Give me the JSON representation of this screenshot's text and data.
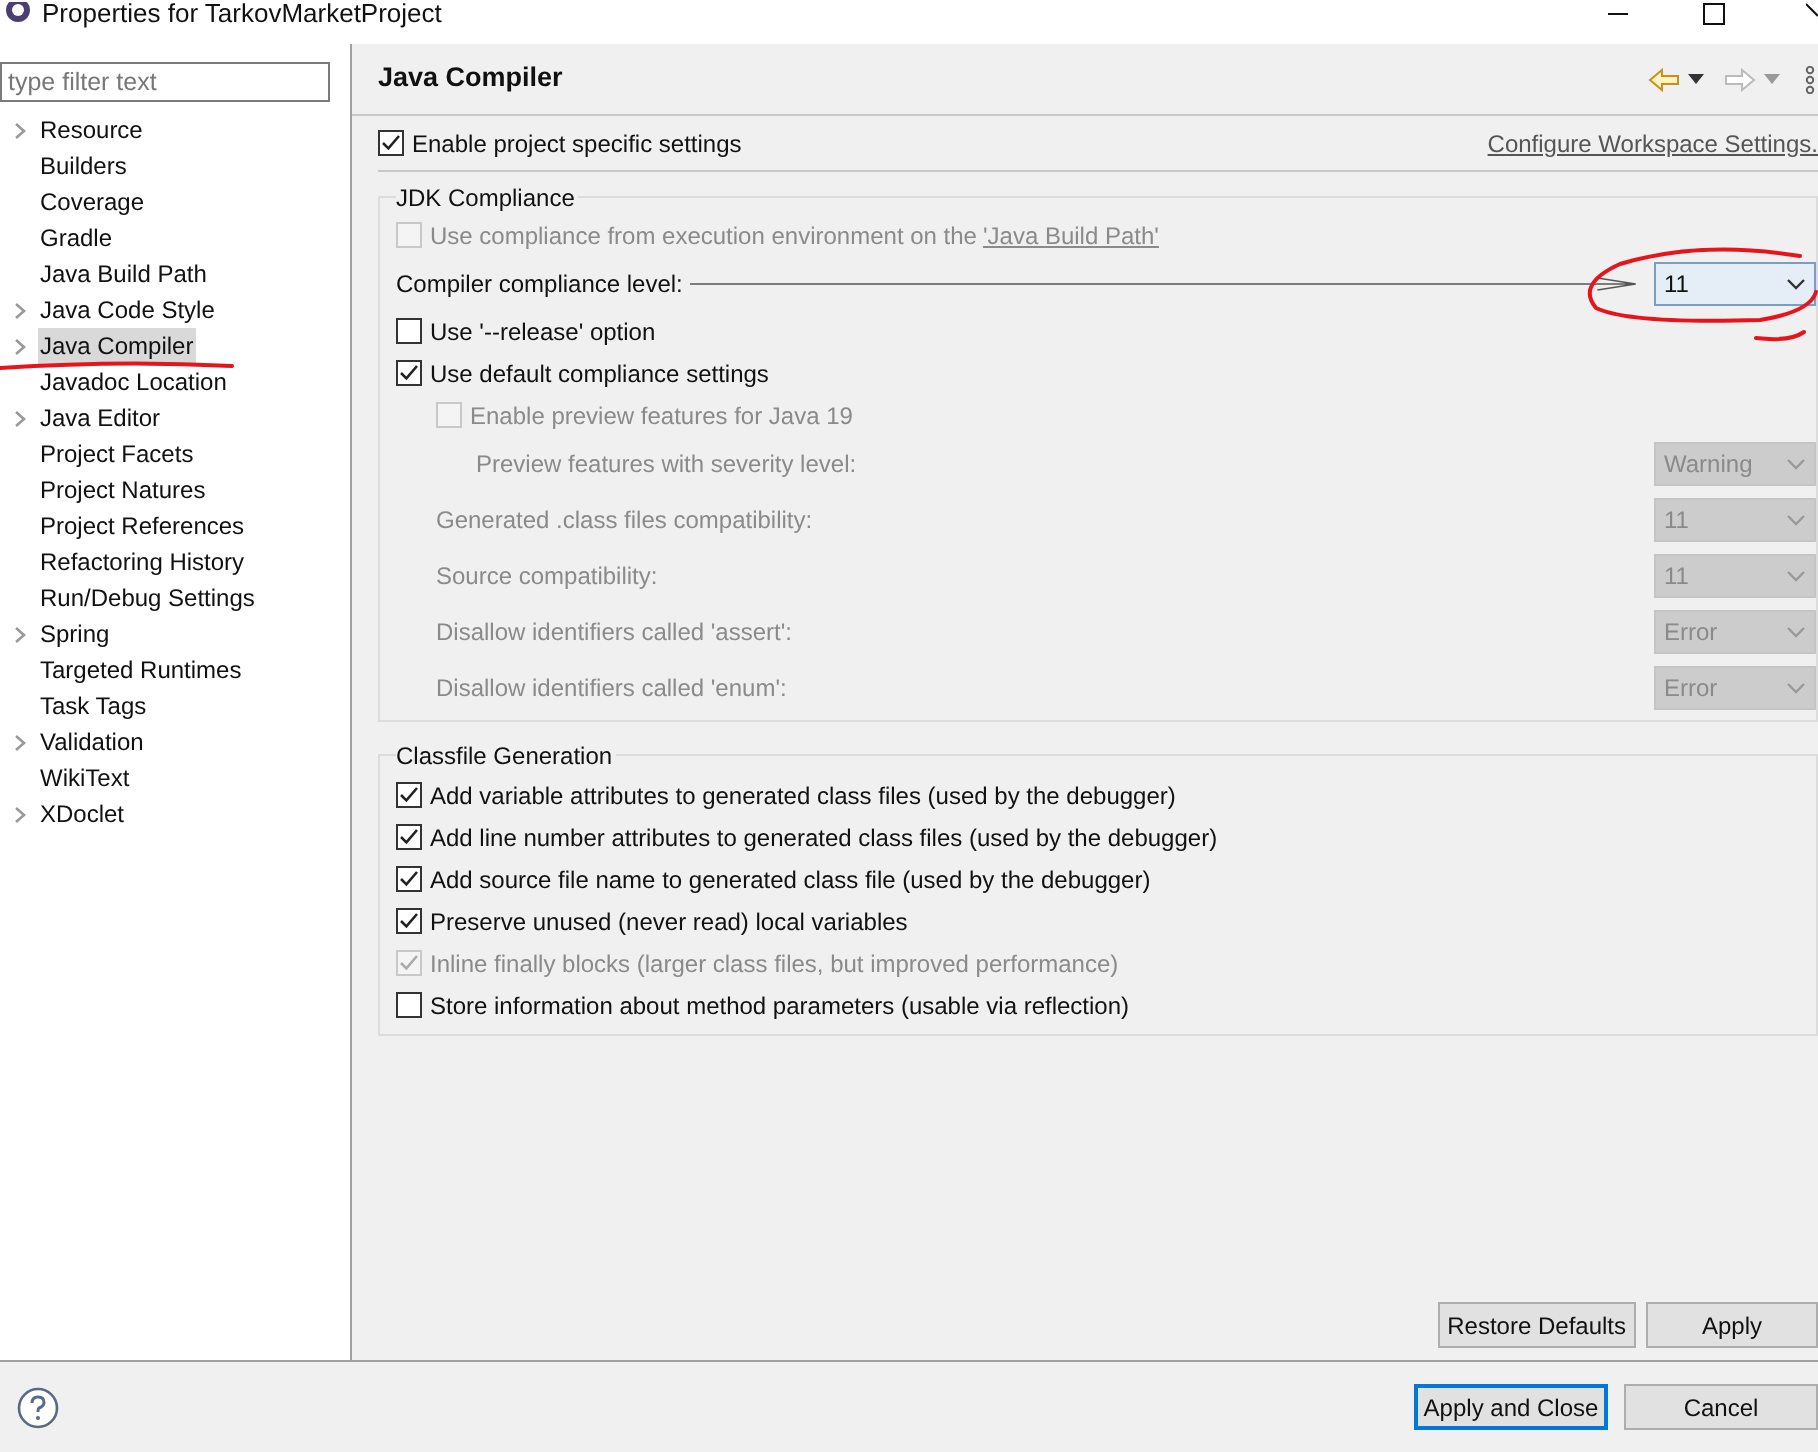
{
  "window": {
    "title": "Properties for TarkovMarketProject"
  },
  "sidebar": {
    "filter": {
      "placeholder": "type filter text"
    },
    "items": [
      {
        "label": "Resource",
        "expandable": true,
        "selected": false
      },
      {
        "label": "Builders",
        "expandable": false,
        "selected": false
      },
      {
        "label": "Coverage",
        "expandable": false,
        "selected": false
      },
      {
        "label": "Gradle",
        "expandable": false,
        "selected": false
      },
      {
        "label": "Java Build Path",
        "expandable": false,
        "selected": false
      },
      {
        "label": "Java Code Style",
        "expandable": true,
        "selected": false
      },
      {
        "label": "Java Compiler",
        "expandable": true,
        "selected": true
      },
      {
        "label": "Javadoc Location",
        "expandable": false,
        "selected": false
      },
      {
        "label": "Java Editor",
        "expandable": true,
        "selected": false
      },
      {
        "label": "Project Facets",
        "expandable": false,
        "selected": false
      },
      {
        "label": "Project Natures",
        "expandable": false,
        "selected": false
      },
      {
        "label": "Project References",
        "expandable": false,
        "selected": false
      },
      {
        "label": "Refactoring History",
        "expandable": false,
        "selected": false
      },
      {
        "label": "Run/Debug Settings",
        "expandable": false,
        "selected": false
      },
      {
        "label": "Spring",
        "expandable": true,
        "selected": false
      },
      {
        "label": "Targeted Runtimes",
        "expandable": false,
        "selected": false
      },
      {
        "label": "Task Tags",
        "expandable": false,
        "selected": false
      },
      {
        "label": "Validation",
        "expandable": true,
        "selected": false
      },
      {
        "label": "WikiText",
        "expandable": false,
        "selected": false
      },
      {
        "label": "XDoclet",
        "expandable": true,
        "selected": false
      }
    ]
  },
  "page": {
    "title": "Java Compiler",
    "enable_specific": {
      "label": "Enable project specific settings",
      "checked": true
    },
    "configure_link": "Configure Workspace Settings.",
    "jdk": {
      "title": "JDK Compliance",
      "use_ee": {
        "label": "Use compliance from execution environment on the ",
        "link": "'Java Build Path'",
        "checked": false,
        "disabled": true
      },
      "level": {
        "label": "Compiler compliance level:",
        "value": "11"
      },
      "release": {
        "label": "Use '--release' option",
        "checked": false,
        "disabled": false
      },
      "defaults": {
        "label": "Use default compliance settings",
        "checked": true,
        "disabled": false
      },
      "preview": {
        "label": "Enable preview features for Java 19",
        "checked": false,
        "disabled": true,
        "severity": {
          "label": "Preview features with severity level:",
          "value": "Warning",
          "disabled": true
        }
      },
      "settings": [
        {
          "label": "Generated .class files compatibility:",
          "value": "11",
          "disabled": true
        },
        {
          "label": "Source compatibility:",
          "value": "11",
          "disabled": true
        },
        {
          "label": "Disallow identifiers called 'assert':",
          "value": "Error",
          "disabled": true
        },
        {
          "label": "Disallow identifiers called 'enum':",
          "value": "Error",
          "disabled": true
        }
      ]
    },
    "classfile": {
      "title": "Classfile Generation",
      "options": [
        {
          "label": "Add variable attributes to generated class files (used by the debugger)",
          "checked": true,
          "disabled": false
        },
        {
          "label": "Add line number attributes to generated class files (used by the debugger)",
          "checked": true,
          "disabled": false
        },
        {
          "label": "Add source file name to generated class file (used by the debugger)",
          "checked": true,
          "disabled": false
        },
        {
          "label": "Preserve unused (never read) local variables",
          "checked": true,
          "disabled": false
        },
        {
          "label": "Inline finally blocks (larger class files, but improved performance)",
          "checked": true,
          "disabled": true
        },
        {
          "label": "Store information about method parameters (usable via reflection)",
          "checked": false,
          "disabled": false
        }
      ]
    },
    "buttons": {
      "restore": "Restore Defaults",
      "apply": "Apply"
    }
  },
  "footer": {
    "apply_close": {
      "label": "Apply and Close",
      "default": true
    },
    "cancel": {
      "label": "Cancel",
      "default": false
    }
  }
}
